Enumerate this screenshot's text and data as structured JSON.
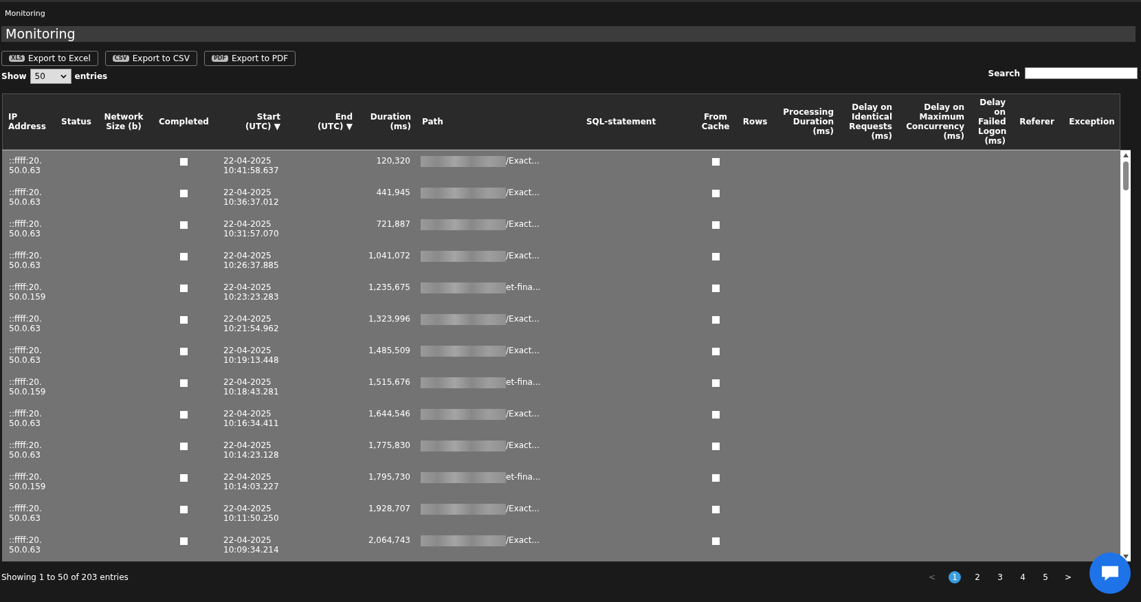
{
  "breadcrumb": "Monitoring",
  "title": "Monitoring",
  "export_buttons": [
    {
      "badge": "XLS",
      "label": "Export to Excel"
    },
    {
      "badge": "CSV",
      "label": "Export to CSV"
    },
    {
      "badge": "PDF",
      "label": "Export to PDF"
    }
  ],
  "length_menu": {
    "before": "Show",
    "value": "50",
    "after": "entries"
  },
  "search": {
    "label": "Search"
  },
  "table": {
    "columns": [
      {
        "label": "IP Address"
      },
      {
        "label": "Status"
      },
      {
        "label": "Network Size (b)"
      },
      {
        "label": "Completed"
      },
      {
        "label": "Start (UTC) ▼"
      },
      {
        "label": "End (UTC) ▼"
      },
      {
        "label": "Duration (ms)"
      },
      {
        "label": "Path"
      },
      {
        "label": "SQL-statement"
      },
      {
        "label": "From Cache"
      },
      {
        "label": "Rows"
      },
      {
        "label": "Processing Duration (ms)"
      },
      {
        "label": "Delay on Identical Requests (ms)"
      },
      {
        "label": "Delay on Maximum Concurrency (ms)"
      },
      {
        "label": "Delay on Failed Logon (ms)"
      },
      {
        "label": "Referer"
      },
      {
        "label": "Exception"
      }
    ],
    "rows": [
      {
        "ip": "::ffff:20.50.0.63",
        "completed": false,
        "start": "22-04-2025 10:41:58.637",
        "duration": "120,320",
        "path": "/Exact...",
        "from_cache": false
      },
      {
        "ip": "::ffff:20.50.0.63",
        "completed": false,
        "start": "22-04-2025 10:36:37.012",
        "duration": "441,945",
        "path": "/Exact...",
        "from_cache": false
      },
      {
        "ip": "::ffff:20.50.0.63",
        "completed": false,
        "start": "22-04-2025 10:31:57.070",
        "duration": "721,887",
        "path": "/Exact...",
        "from_cache": false
      },
      {
        "ip": "::ffff:20.50.0.63",
        "completed": false,
        "start": "22-04-2025 10:26:37.885",
        "duration": "1,041,072",
        "path": "/Exact...",
        "from_cache": false
      },
      {
        "ip": "::ffff:20.50.0.159",
        "completed": false,
        "start": "22-04-2025 10:23:23.283",
        "duration": "1,235,675",
        "path": "et-fina...",
        "from_cache": false
      },
      {
        "ip": "::ffff:20.50.0.63",
        "completed": false,
        "start": "22-04-2025 10:21:54.962",
        "duration": "1,323,996",
        "path": "/Exact...",
        "from_cache": false
      },
      {
        "ip": "::ffff:20.50.0.63",
        "completed": false,
        "start": "22-04-2025 10:19:13.448",
        "duration": "1,485,509",
        "path": "/Exact...",
        "from_cache": false
      },
      {
        "ip": "::ffff:20.50.0.159",
        "completed": false,
        "start": "22-04-2025 10:18:43.281",
        "duration": "1,515,676",
        "path": "et-fina...",
        "from_cache": false
      },
      {
        "ip": "::ffff:20.50.0.63",
        "completed": false,
        "start": "22-04-2025 10:16:34.411",
        "duration": "1,644,546",
        "path": "/Exact...",
        "from_cache": false
      },
      {
        "ip": "::ffff:20.50.0.63",
        "completed": false,
        "start": "22-04-2025 10:14:23.128",
        "duration": "1,775,830",
        "path": "/Exact...",
        "from_cache": false
      },
      {
        "ip": "::ffff:20.50.0.159",
        "completed": false,
        "start": "22-04-2025 10:14:03.227",
        "duration": "1,795,730",
        "path": "et-fina...",
        "from_cache": false
      },
      {
        "ip": "::ffff:20.50.0.63",
        "completed": false,
        "start": "22-04-2025 10:11:50.250",
        "duration": "1,928,707",
        "path": "/Exact...",
        "from_cache": false
      },
      {
        "ip": "::ffff:20.50.0.63",
        "completed": false,
        "start": "22-04-2025 10:09:34.214",
        "duration": "2,064,743",
        "path": "/Exact...",
        "from_cache": false
      }
    ]
  },
  "info": "Showing 1 to 50 of 203 entries",
  "pagination": {
    "previous": "<",
    "next": ">",
    "pages": [
      {
        "label": "1",
        "selected": true
      },
      {
        "label": "2",
        "selected": false
      },
      {
        "label": "3",
        "selected": false
      },
      {
        "label": "4",
        "selected": false
      },
      {
        "label": "5",
        "selected": false
      }
    ]
  }
}
